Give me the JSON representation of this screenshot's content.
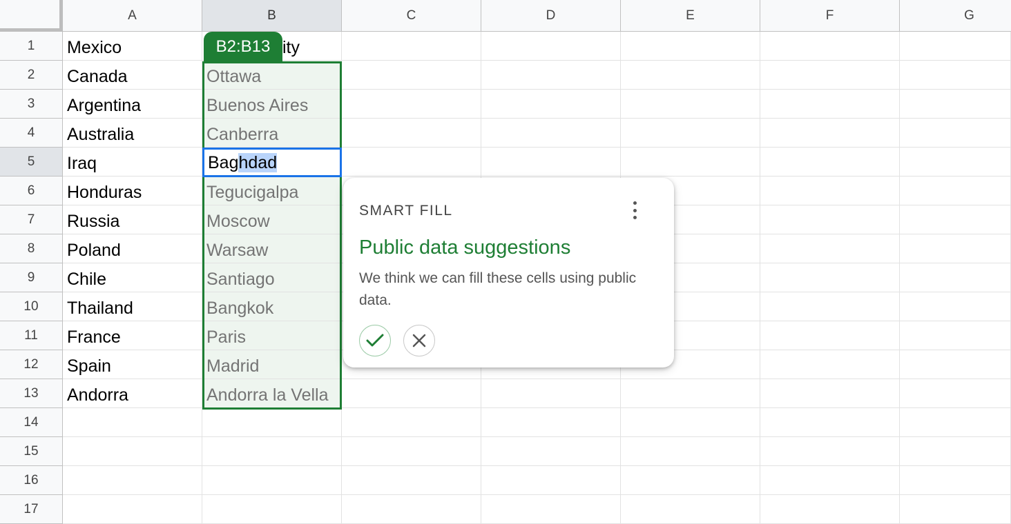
{
  "columns": [
    "A",
    "B",
    "C",
    "D",
    "E",
    "F",
    "G"
  ],
  "rows": [
    "1",
    "2",
    "3",
    "4",
    "5",
    "6",
    "7",
    "8",
    "9",
    "10",
    "11",
    "12",
    "13",
    "14",
    "15",
    "16",
    "17"
  ],
  "column_a": [
    "Mexico",
    "Canada",
    "Argentina",
    "Australia",
    "Iraq",
    "Honduras",
    "Russia",
    "Poland",
    "Chile",
    "Thailand",
    "France",
    "Spain",
    "Andorra"
  ],
  "column_b": {
    "header_visible_tail": "ity",
    "range_label": "B2:B13",
    "suggestions": [
      "Ottawa",
      "Buenos Aires",
      "Canberra",
      "",
      "Tegucigalpa",
      "Moscow",
      "Warsaw",
      "Santiago",
      "Bangkok",
      "Paris",
      "Madrid",
      "Andorra la Vella"
    ],
    "active_cell": {
      "typed": "Bag",
      "autocomplete": "hdad"
    }
  },
  "smart_fill": {
    "eyebrow": "SMART FILL",
    "heading": "Public data suggestions",
    "body": "We think we can fill these cells using public data.",
    "accept_icon": "check-icon",
    "reject_icon": "close-icon",
    "menu_icon": "more-vert-icon"
  },
  "colors": {
    "accent_green": "#1e7e34",
    "selection_blue": "#1a73e8",
    "autocomplete_highlight": "#b9d4fa"
  }
}
